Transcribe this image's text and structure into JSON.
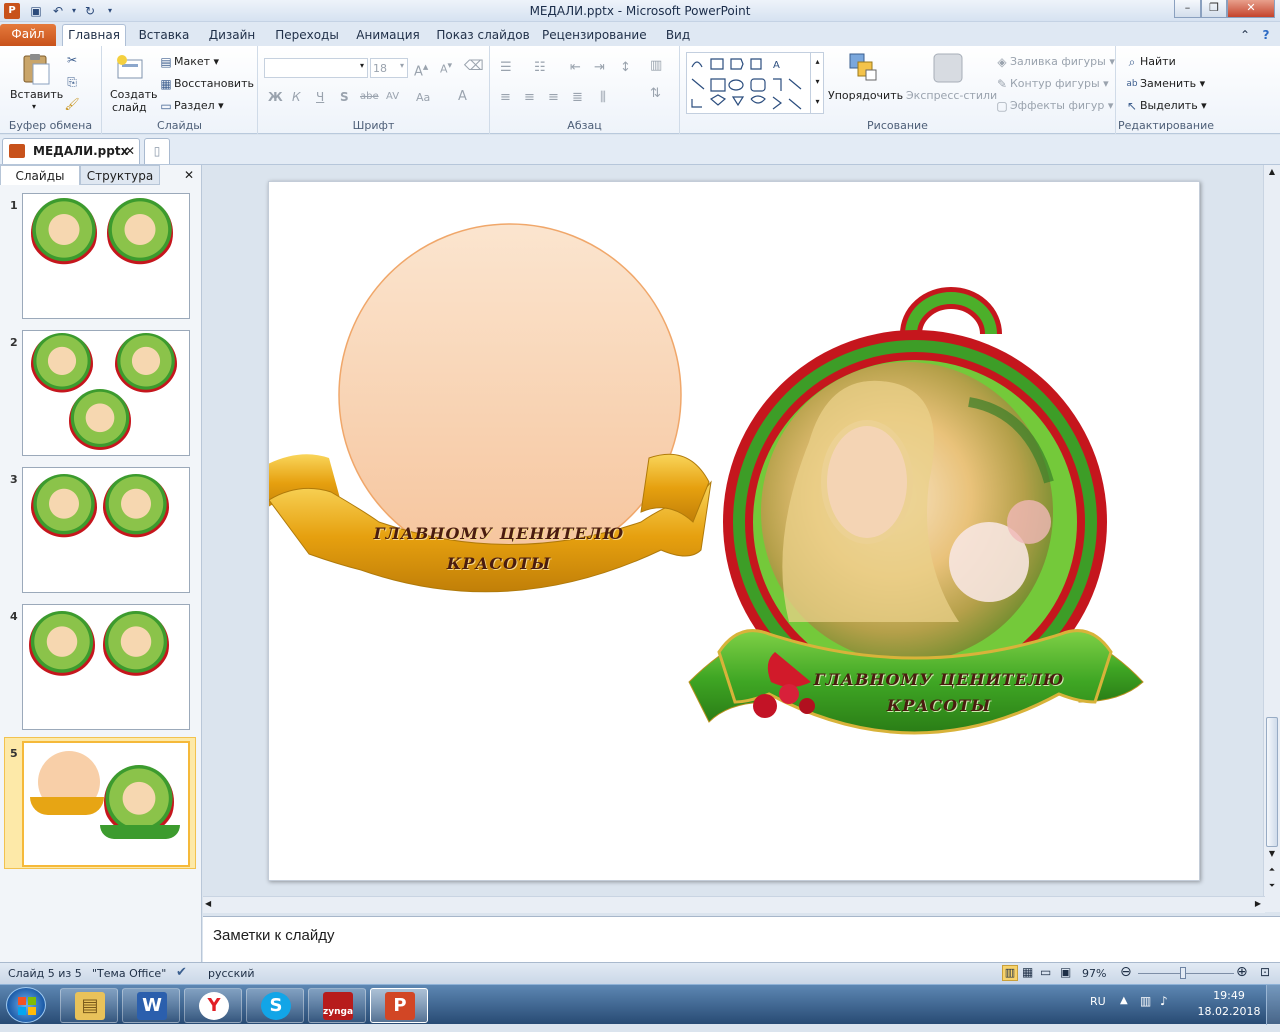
{
  "window": {
    "title": "МЕДАЛИ.pptx - Microsoft PowerPoint",
    "minimize": "–",
    "maximize": "❐",
    "close": "✕"
  },
  "tabs": {
    "file": "Файл",
    "home": "Главная",
    "insert": "Вставка",
    "design": "Дизайн",
    "transitions": "Переходы",
    "animation": "Анимация",
    "slideshow": "Показ слайдов",
    "review": "Рецензирование",
    "view": "Вид"
  },
  "ribbon": {
    "clipboard": {
      "paste": "Вставить",
      "label": "Буфер обмена"
    },
    "slides": {
      "new_slide_1": "Создать",
      "new_slide_2": "слайд",
      "layout": "Макет",
      "reset": "Восстановить",
      "section": "Раздел",
      "label": "Слайды"
    },
    "font": {
      "size": "18",
      "bold": "Ж",
      "italic": "К",
      "underline": "Ч",
      "shadow": "S",
      "strike": "abe",
      "spacing": "AV",
      "case": "Aa",
      "color": "A",
      "label": "Шрифт"
    },
    "paragraph": {
      "label": "Абзац"
    },
    "drawing": {
      "arrange": "Упорядочить",
      "quick_styles": "Экспресс-стили",
      "fill": "Заливка фигуры",
      "outline": "Контур фигуры",
      "effects": "Эффекты фигур",
      "label": "Рисование"
    },
    "editing": {
      "find": "Найти",
      "replace": "Заменить",
      "select": "Выделить",
      "label": "Редактирование"
    }
  },
  "document_tab": "МЕДАЛИ.pptx",
  "left_pane": {
    "tab_slides": "Слайды",
    "tab_outline": "Структура",
    "thumbnails": [
      {
        "number": "1"
      },
      {
        "number": "2"
      },
      {
        "number": "3"
      },
      {
        "number": "4"
      },
      {
        "number": "5"
      }
    ]
  },
  "slide": {
    "left_medal_text_1": "ГЛАВНОМУ ЦЕНИТЕЛЮ",
    "left_medal_text_2": "КРАСОТЫ",
    "right_medal_text_1": "ГЛАВНОМУ ЦЕНИТЕЛЮ",
    "right_medal_text_2": "КРАСОТЫ"
  },
  "notes_placeholder": "Заметки к слайду",
  "status": {
    "slide_indicator": "Слайд 5 из 5",
    "theme": "\"Тема Office\"",
    "language": "русский",
    "zoom": "97%"
  },
  "taskbar": {
    "lang": "RU",
    "time": "19:49",
    "date": "18.02.2018",
    "zynga_label": "zynga"
  },
  "colors": {
    "medal_green": "#4caf2a",
    "medal_red": "#c5161d",
    "ribbon_gold": "#e7a514",
    "peach": "#f8cfa8"
  }
}
